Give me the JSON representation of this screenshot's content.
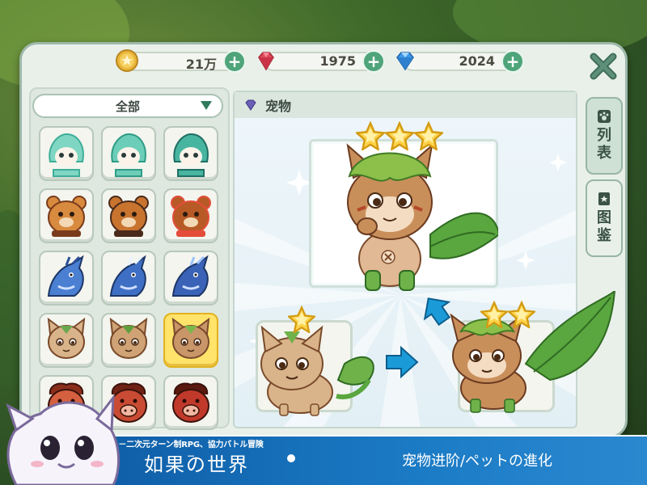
{
  "currency": {
    "gold": {
      "value": "21万",
      "color": "#e9b53a"
    },
    "ruby": {
      "value": "1975",
      "color": "#e04a5a"
    },
    "diamond": {
      "value": "2024",
      "color": "#3f9ae8"
    },
    "plus": "+"
  },
  "filter": {
    "label": "全部"
  },
  "content": {
    "header": "宠物"
  },
  "tabs": {
    "list": [
      "列",
      "表"
    ],
    "dex": [
      "图",
      "鉴"
    ]
  },
  "banner": {
    "subtitle": "－二次元ターン制RPG、協力バトル冒険－",
    "title": "如果の世界",
    "right": "宠物进阶/ペットの進化"
  },
  "pets": [
    {
      "kind": "spirit",
      "body": "#7fd6c3",
      "accent": "#3fae98"
    },
    {
      "kind": "spirit",
      "body": "#6ccdb8",
      "accent": "#2f9c86"
    },
    {
      "kind": "spirit",
      "body": "#48b5a0",
      "accent": "#1f6f63"
    },
    {
      "kind": "bear",
      "body": "#d88a3e",
      "accent": "#7a3b1c"
    },
    {
      "kind": "bear",
      "body": "#c8742f",
      "accent": "#4a2a1a"
    },
    {
      "kind": "bear",
      "body": "#b85a26",
      "accent": "#e34d3a"
    },
    {
      "kind": "dragon",
      "body": "#4a7fd1",
      "accent": "#2a4f98"
    },
    {
      "kind": "dragon",
      "body": "#3f6fc4",
      "accent": "#e8f2ff"
    },
    {
      "kind": "dragon",
      "body": "#3a62b6",
      "accent": "#9cc2ff"
    },
    {
      "kind": "cat",
      "body": "#d9b48a",
      "accent": "#6aa84f"
    },
    {
      "kind": "cat",
      "body": "#cfa375",
      "accent": "#5f9e3f"
    },
    {
      "kind": "cat",
      "body": "#c9966a",
      "accent": "#7bb84c",
      "selected": true
    },
    {
      "kind": "boar",
      "body": "#d5603f",
      "accent": "#8a2e1c"
    },
    {
      "kind": "boar",
      "body": "#c94b34",
      "accent": "#6f2215"
    },
    {
      "kind": "boar",
      "body": "#c0392b",
      "accent": "#5a1a10"
    }
  ],
  "stars": {
    "main": 3,
    "before": 1,
    "after": 2
  },
  "colors": {
    "panel": "#e9f0ea",
    "accent": "#4fa47a",
    "banner": "#1c7cc6"
  }
}
